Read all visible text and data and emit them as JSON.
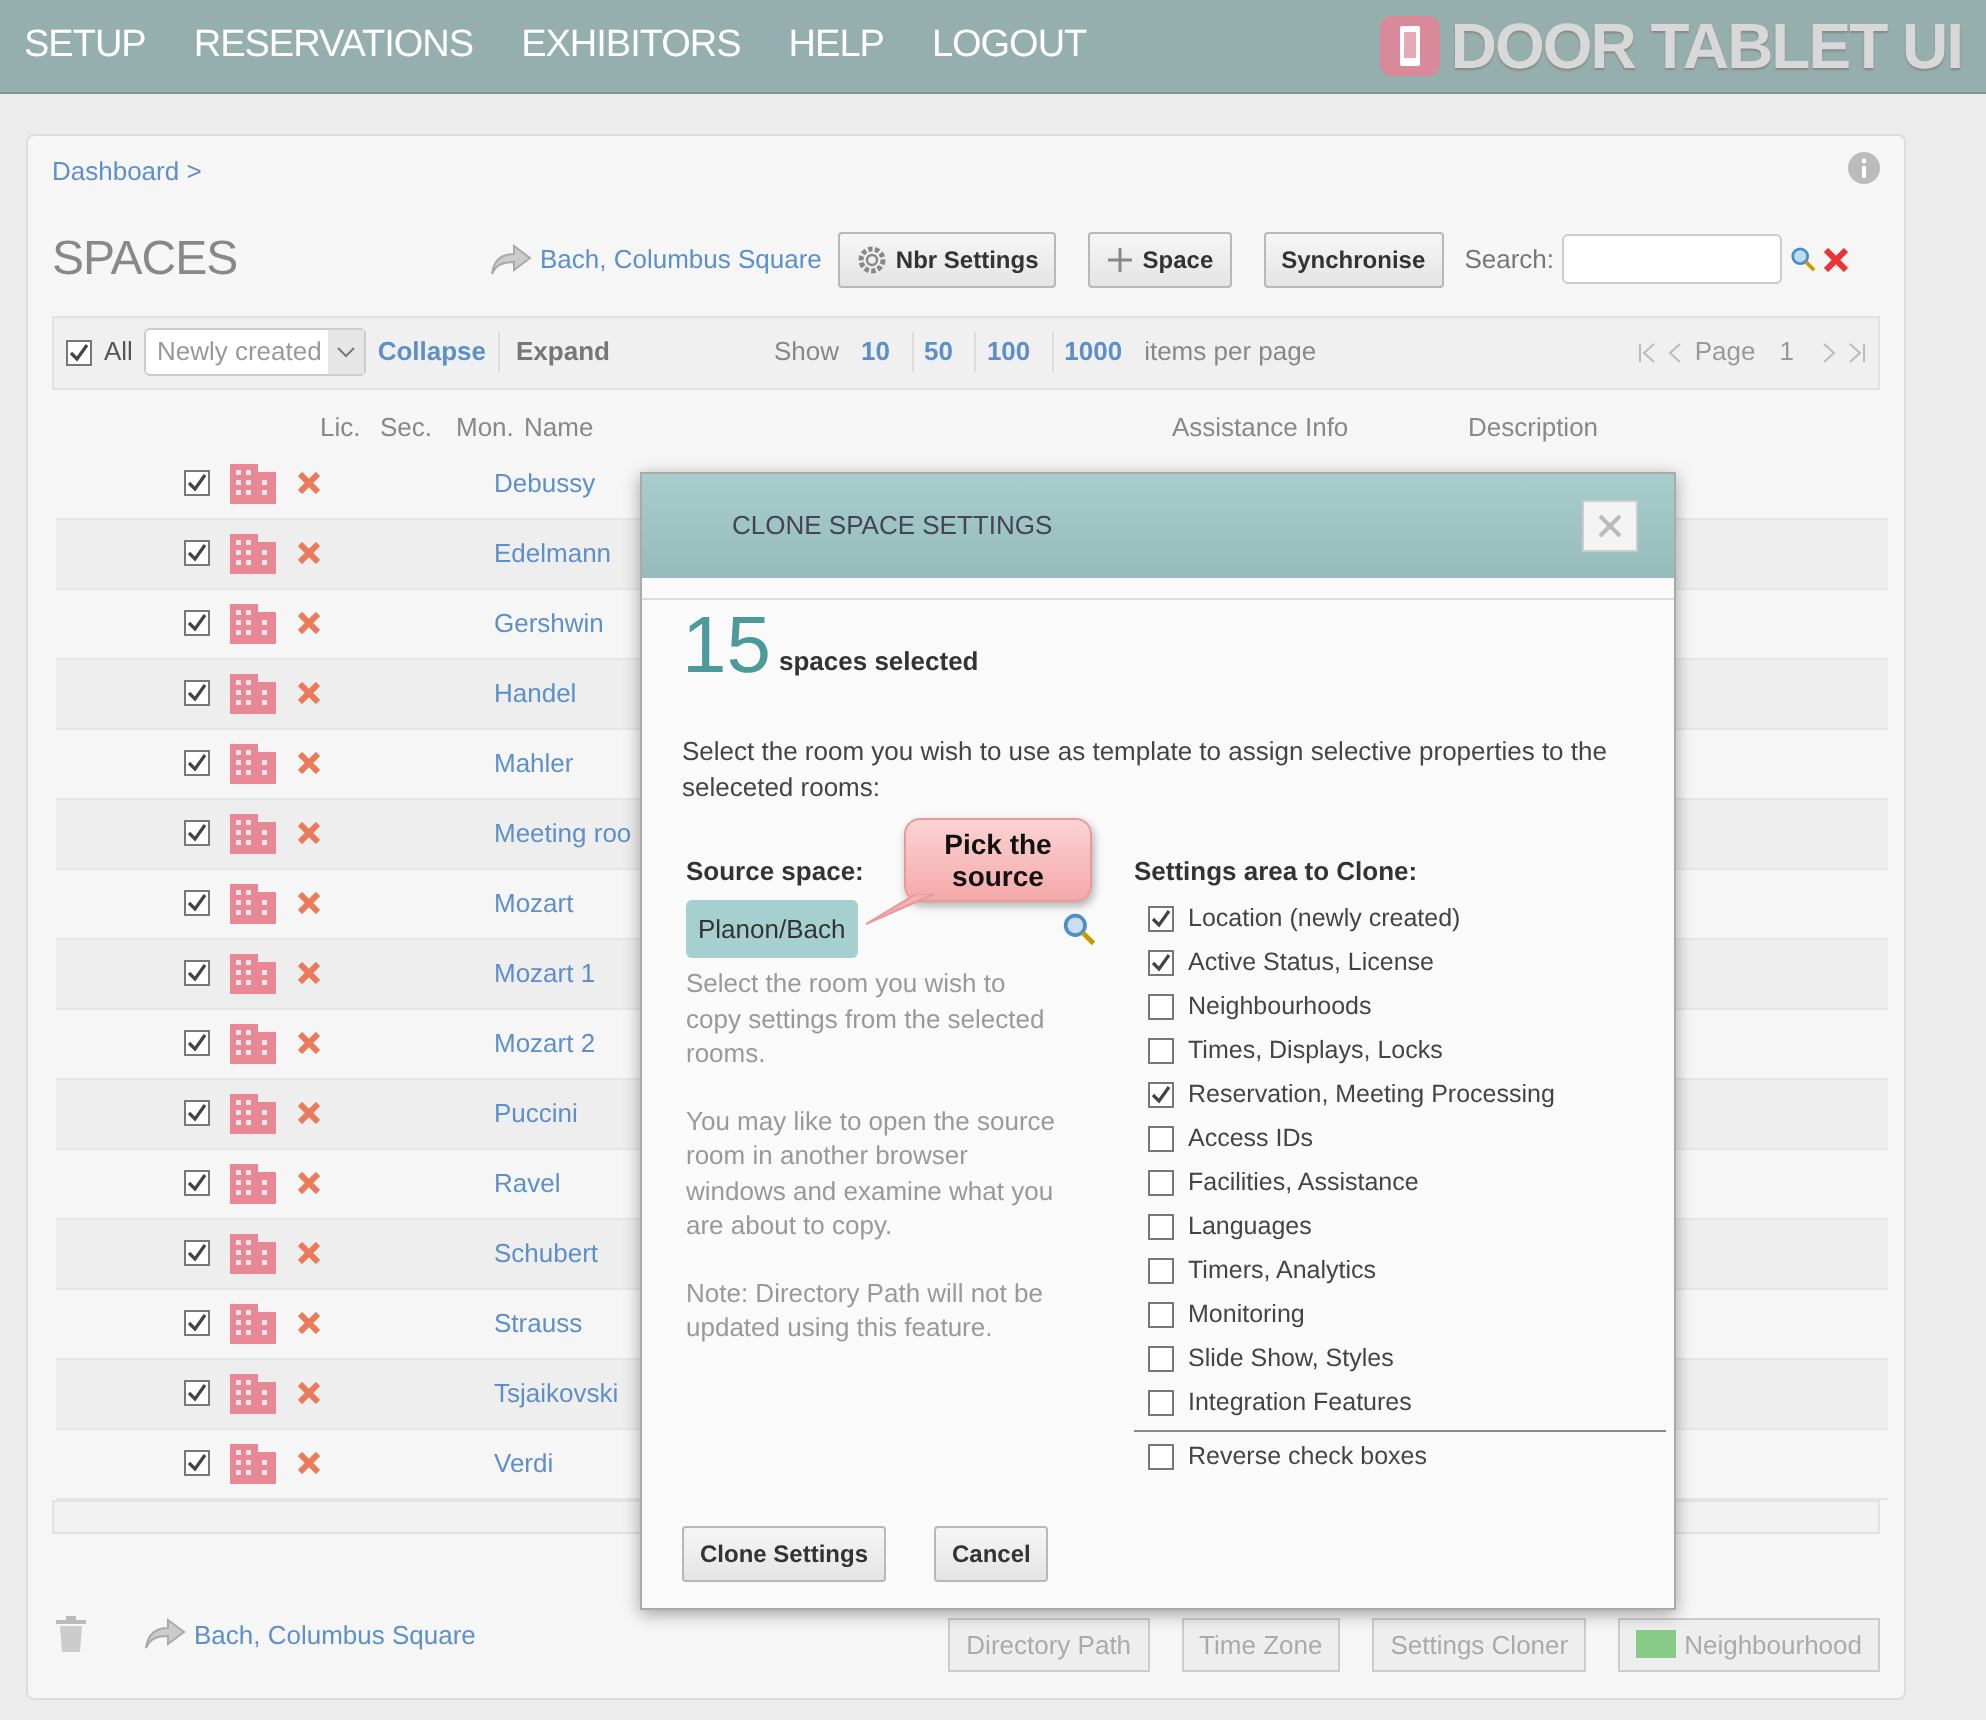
{
  "nav": {
    "items": [
      "SETUP",
      "RESERVATIONS",
      "EXHIBITORS",
      "HELP",
      "LOGOUT"
    ],
    "logo": "DOOR TABLET UI"
  },
  "breadcrumb": "Dashboard >",
  "page_title": "SPACES",
  "location_link": "Bach, Columbus Square",
  "toolbar_buttons": [
    {
      "label": "Nbr Settings",
      "kind": "gear"
    },
    {
      "label": "Space",
      "kind": "plus"
    },
    {
      "label": "Synchronise",
      "kind": "plain"
    }
  ],
  "search": {
    "label": "Search:"
  },
  "list_bar": {
    "all_label": "All",
    "all_checked": true,
    "filter": "Newly created",
    "collapse": "Collapse",
    "expand": "Expand",
    "show": "Show",
    "page_sizes": [
      "10",
      "50",
      "100",
      "1000"
    ],
    "per_page": "items per page",
    "page_label": "Page",
    "page": "1"
  },
  "table": {
    "columns": [
      "Lic.",
      "Sec.",
      "Mon.",
      "Name",
      "Assistance Info",
      "Description"
    ],
    "rows": [
      {
        "checked": true,
        "name": "Debussy"
      },
      {
        "checked": true,
        "name": "Edelmann"
      },
      {
        "checked": true,
        "name": "Gershwin"
      },
      {
        "checked": true,
        "name": "Handel"
      },
      {
        "checked": true,
        "name": "Mahler"
      },
      {
        "checked": true,
        "name": "Meeting roo"
      },
      {
        "checked": true,
        "name": "Mozart"
      },
      {
        "checked": true,
        "name": "Mozart 1"
      },
      {
        "checked": true,
        "name": "Mozart 2"
      },
      {
        "checked": true,
        "name": "Puccini"
      },
      {
        "checked": true,
        "name": "Ravel"
      },
      {
        "checked": true,
        "name": "Schubert"
      },
      {
        "checked": true,
        "name": "Strauss"
      },
      {
        "checked": true,
        "name": "Tsjaikovski"
      },
      {
        "checked": true,
        "name": "Verdi"
      }
    ]
  },
  "footer": {
    "location_link": "Bach, Columbus Square",
    "buttons": [
      "Directory Path",
      "Time Zone",
      "Settings Cloner",
      "Neighbourhood"
    ]
  },
  "dialog": {
    "title": "CLONE SPACE SETTINGS",
    "count": "15",
    "count_label": "spaces selected",
    "intro": "Select the room you wish to use as template to assign selective properties to the seleceted rooms:",
    "source_label": "Source space:",
    "source_value": "Planon/Bach",
    "source_help": "Select the room you wish to copy settings from the selected rooms.",
    "note_1": "You may like to open the source room in another browser windows and examine what you are about to copy.",
    "note_2": "Note: Directory Path will not be updated using this feature.",
    "settings_label": "Settings area to Clone:",
    "settings": [
      {
        "label": "Location (newly created)",
        "checked": true
      },
      {
        "label": "Active Status, License",
        "checked": true
      },
      {
        "label": "Neighbourhoods",
        "checked": false
      },
      {
        "label": "Times, Displays, Locks",
        "checked": false
      },
      {
        "label": "Reservation, Meeting Processing",
        "checked": true
      },
      {
        "label": "Access IDs",
        "checked": false
      },
      {
        "label": "Facilities, Assistance",
        "checked": false
      },
      {
        "label": "Languages",
        "checked": false
      },
      {
        "label": "Timers, Analytics",
        "checked": false
      },
      {
        "label": "Monitoring",
        "checked": false
      },
      {
        "label": "Slide Show, Styles",
        "checked": false
      },
      {
        "label": "Integration Features",
        "checked": false
      }
    ],
    "reverse": {
      "label": "Reverse check boxes",
      "checked": false
    },
    "buttons": [
      "Clone Settings",
      "Cancel"
    ]
  },
  "callout": "Pick the source"
}
